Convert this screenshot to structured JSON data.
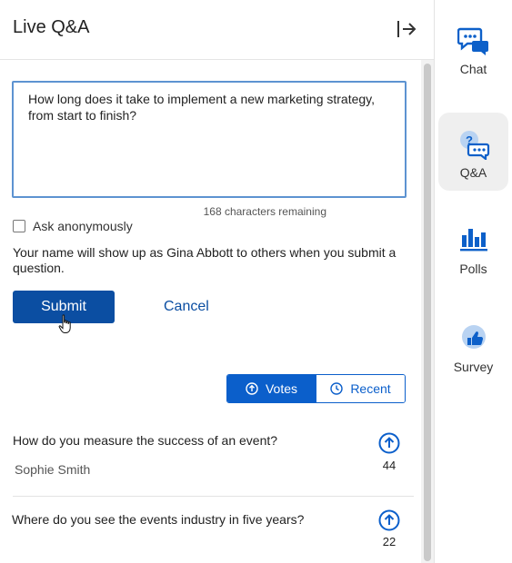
{
  "panel": {
    "title": "Live Q&A",
    "collapse_icon": "collapse-right-icon"
  },
  "compose": {
    "question_value": "How long does it take to implement a new marketing strategy, from start to finish?",
    "chars_remaining": "168 characters remaining",
    "anonymous_label": "Ask anonymously",
    "anonymous_checked": false,
    "name_note": "Your name will show up as Gina Abbott to others when you submit a question.",
    "submit_label": "Submit",
    "cancel_label": "Cancel"
  },
  "sort": {
    "votes_label": "Votes",
    "recent_label": "Recent",
    "active": "Votes"
  },
  "questions": [
    {
      "text": "How do you measure the success of an event?",
      "author": "Sophie Smith",
      "votes": "44"
    },
    {
      "text": "Where do you see the events industry in five years?",
      "author": "",
      "votes": "22"
    }
  ],
  "rail": {
    "items": [
      {
        "label": "Chat",
        "icon": "chat-icon",
        "active": false
      },
      {
        "label": "Q&A",
        "icon": "qa-icon",
        "active": true
      },
      {
        "label": "Polls",
        "icon": "polls-icon",
        "active": false
      },
      {
        "label": "Survey",
        "icon": "survey-icon",
        "active": false
      }
    ]
  },
  "colors": {
    "primary": "#0b4ea2",
    "accent": "#0b5fcb",
    "focus_border": "#5d93d1",
    "rail_icon": "#0d60c9"
  }
}
